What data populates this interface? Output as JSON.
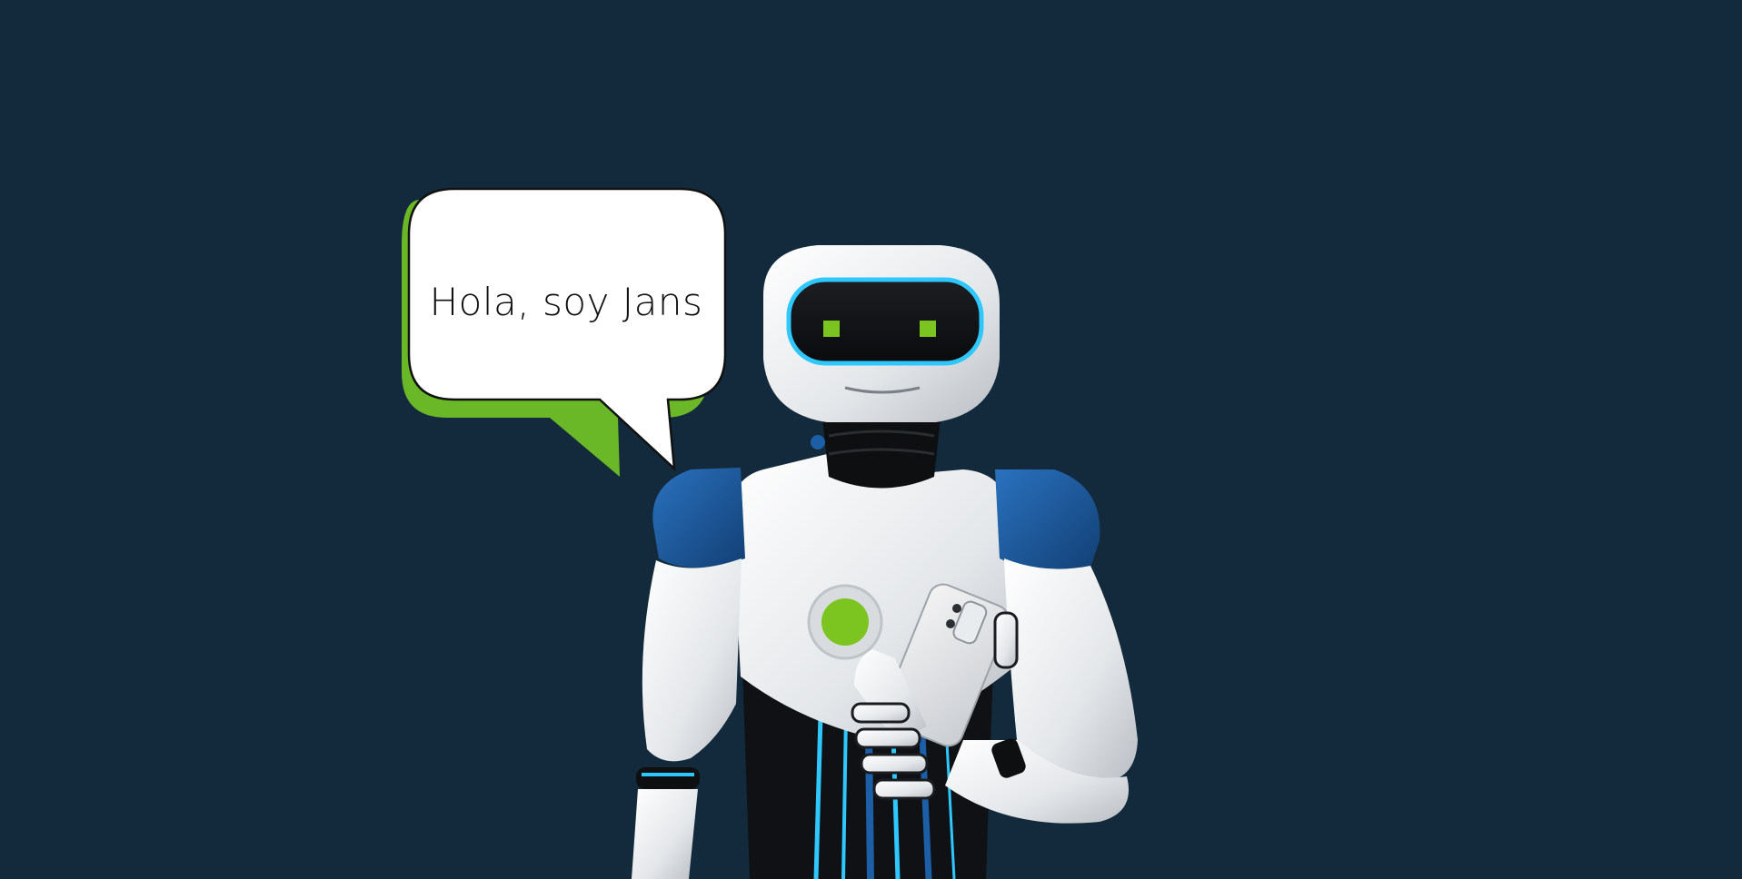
{
  "scene": {
    "background_color": "#122a3b",
    "speech_bubble": {
      "text": "Hola, soy Jans",
      "fill_color": "#ffffff",
      "shadow_color": "#6ab827",
      "outline_color": "#111111"
    },
    "robot": {
      "description_icon": "robot-icon",
      "body_color": "#f2f2f2",
      "accent_blue": "#1d5fa6",
      "glow_cyan": "#2ec8ff",
      "eye_color": "#7cc41f",
      "dark_color": "#111111",
      "holding": "smartphone-icon"
    }
  }
}
